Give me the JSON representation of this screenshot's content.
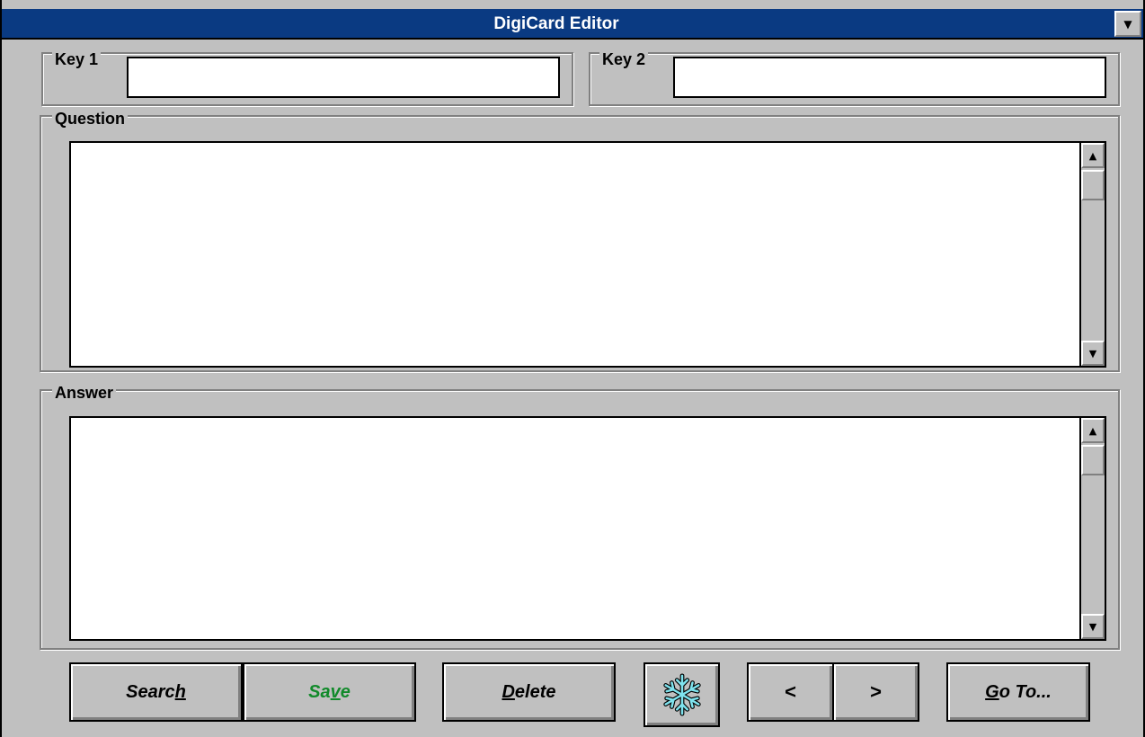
{
  "window": {
    "title": "DigiCard Editor",
    "sysmenu_glyph": "▼"
  },
  "fields": {
    "key1": {
      "label": "Key 1",
      "value": ""
    },
    "key2": {
      "label": "Key 2",
      "value": ""
    },
    "question": {
      "label": "Question",
      "value": ""
    },
    "answer": {
      "label": "Answer",
      "value": ""
    }
  },
  "scroll": {
    "up_glyph": "▲",
    "down_glyph": "▼"
  },
  "buttons": {
    "search": {
      "pre": "Searc",
      "mnemonic": "h",
      "post": ""
    },
    "save": {
      "pre": "Sa",
      "mnemonic": "v",
      "post": "e"
    },
    "delete": {
      "pre": "",
      "mnemonic": "D",
      "post": "elete"
    },
    "prev": {
      "label": "<"
    },
    "next": {
      "label": ">"
    },
    "goto": {
      "pre": "",
      "mnemonic": "G",
      "post": "o To..."
    }
  },
  "icons": {
    "freeze": "snowflake-icon"
  },
  "colors": {
    "title_bar": "#0a3a82",
    "save_text": "#118a2a",
    "face": "#c0c0c0",
    "snowflake": "#7fe3ee"
  }
}
